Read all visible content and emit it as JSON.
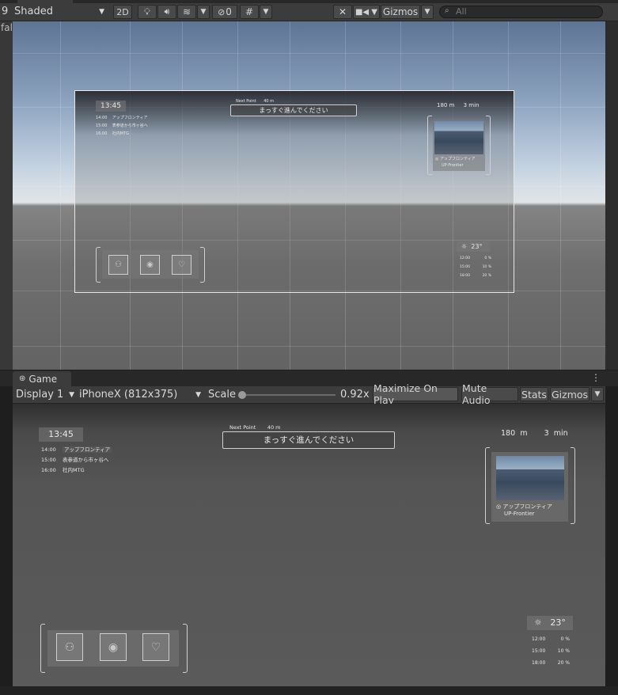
{
  "scene": {
    "left_number": "9",
    "left_cut_label": "fal",
    "shading_mode": "Shaded",
    "btn_2d": "2D",
    "hidden_count": "0",
    "gizmos_label": "Gizmos",
    "search_placeholder": "All"
  },
  "game": {
    "tab_label": "Game",
    "display": "Display 1",
    "resolution": "iPhoneX (812x375)",
    "scale_label": "Scale",
    "scale_value": "0.92x",
    "scale_fraction": 0.0,
    "maximize_label": "Maximize On Play",
    "mute_label": "Mute Audio",
    "stats_label": "Stats",
    "gizmos_label": "Gizmos"
  },
  "hud": {
    "clock": "13:45",
    "schedule": [
      {
        "time": "14:00",
        "text": "アップフロンティア"
      },
      {
        "time": "15:00",
        "text": "表参道から市ヶ谷へ"
      },
      {
        "time": "16:00",
        "text": "社内MTG"
      }
    ],
    "next_point_label": "Next Point",
    "next_point_distance": "40 m",
    "instruction": "まっすぐ進んでください",
    "distance_value": "180",
    "distance_unit": "m",
    "time_value": "3",
    "time_unit": "min",
    "place_name": "アップフロンティア",
    "place_sub": "UP-Frontier",
    "temperature": "23°",
    "forecast": [
      {
        "time": "12:00",
        "pct": "0 %"
      },
      {
        "time": "15:00",
        "pct": "10 %"
      },
      {
        "time": "18:00",
        "pct": "20 %"
      }
    ],
    "icons": [
      "people-icon",
      "camera-icon",
      "heart-icon"
    ]
  }
}
